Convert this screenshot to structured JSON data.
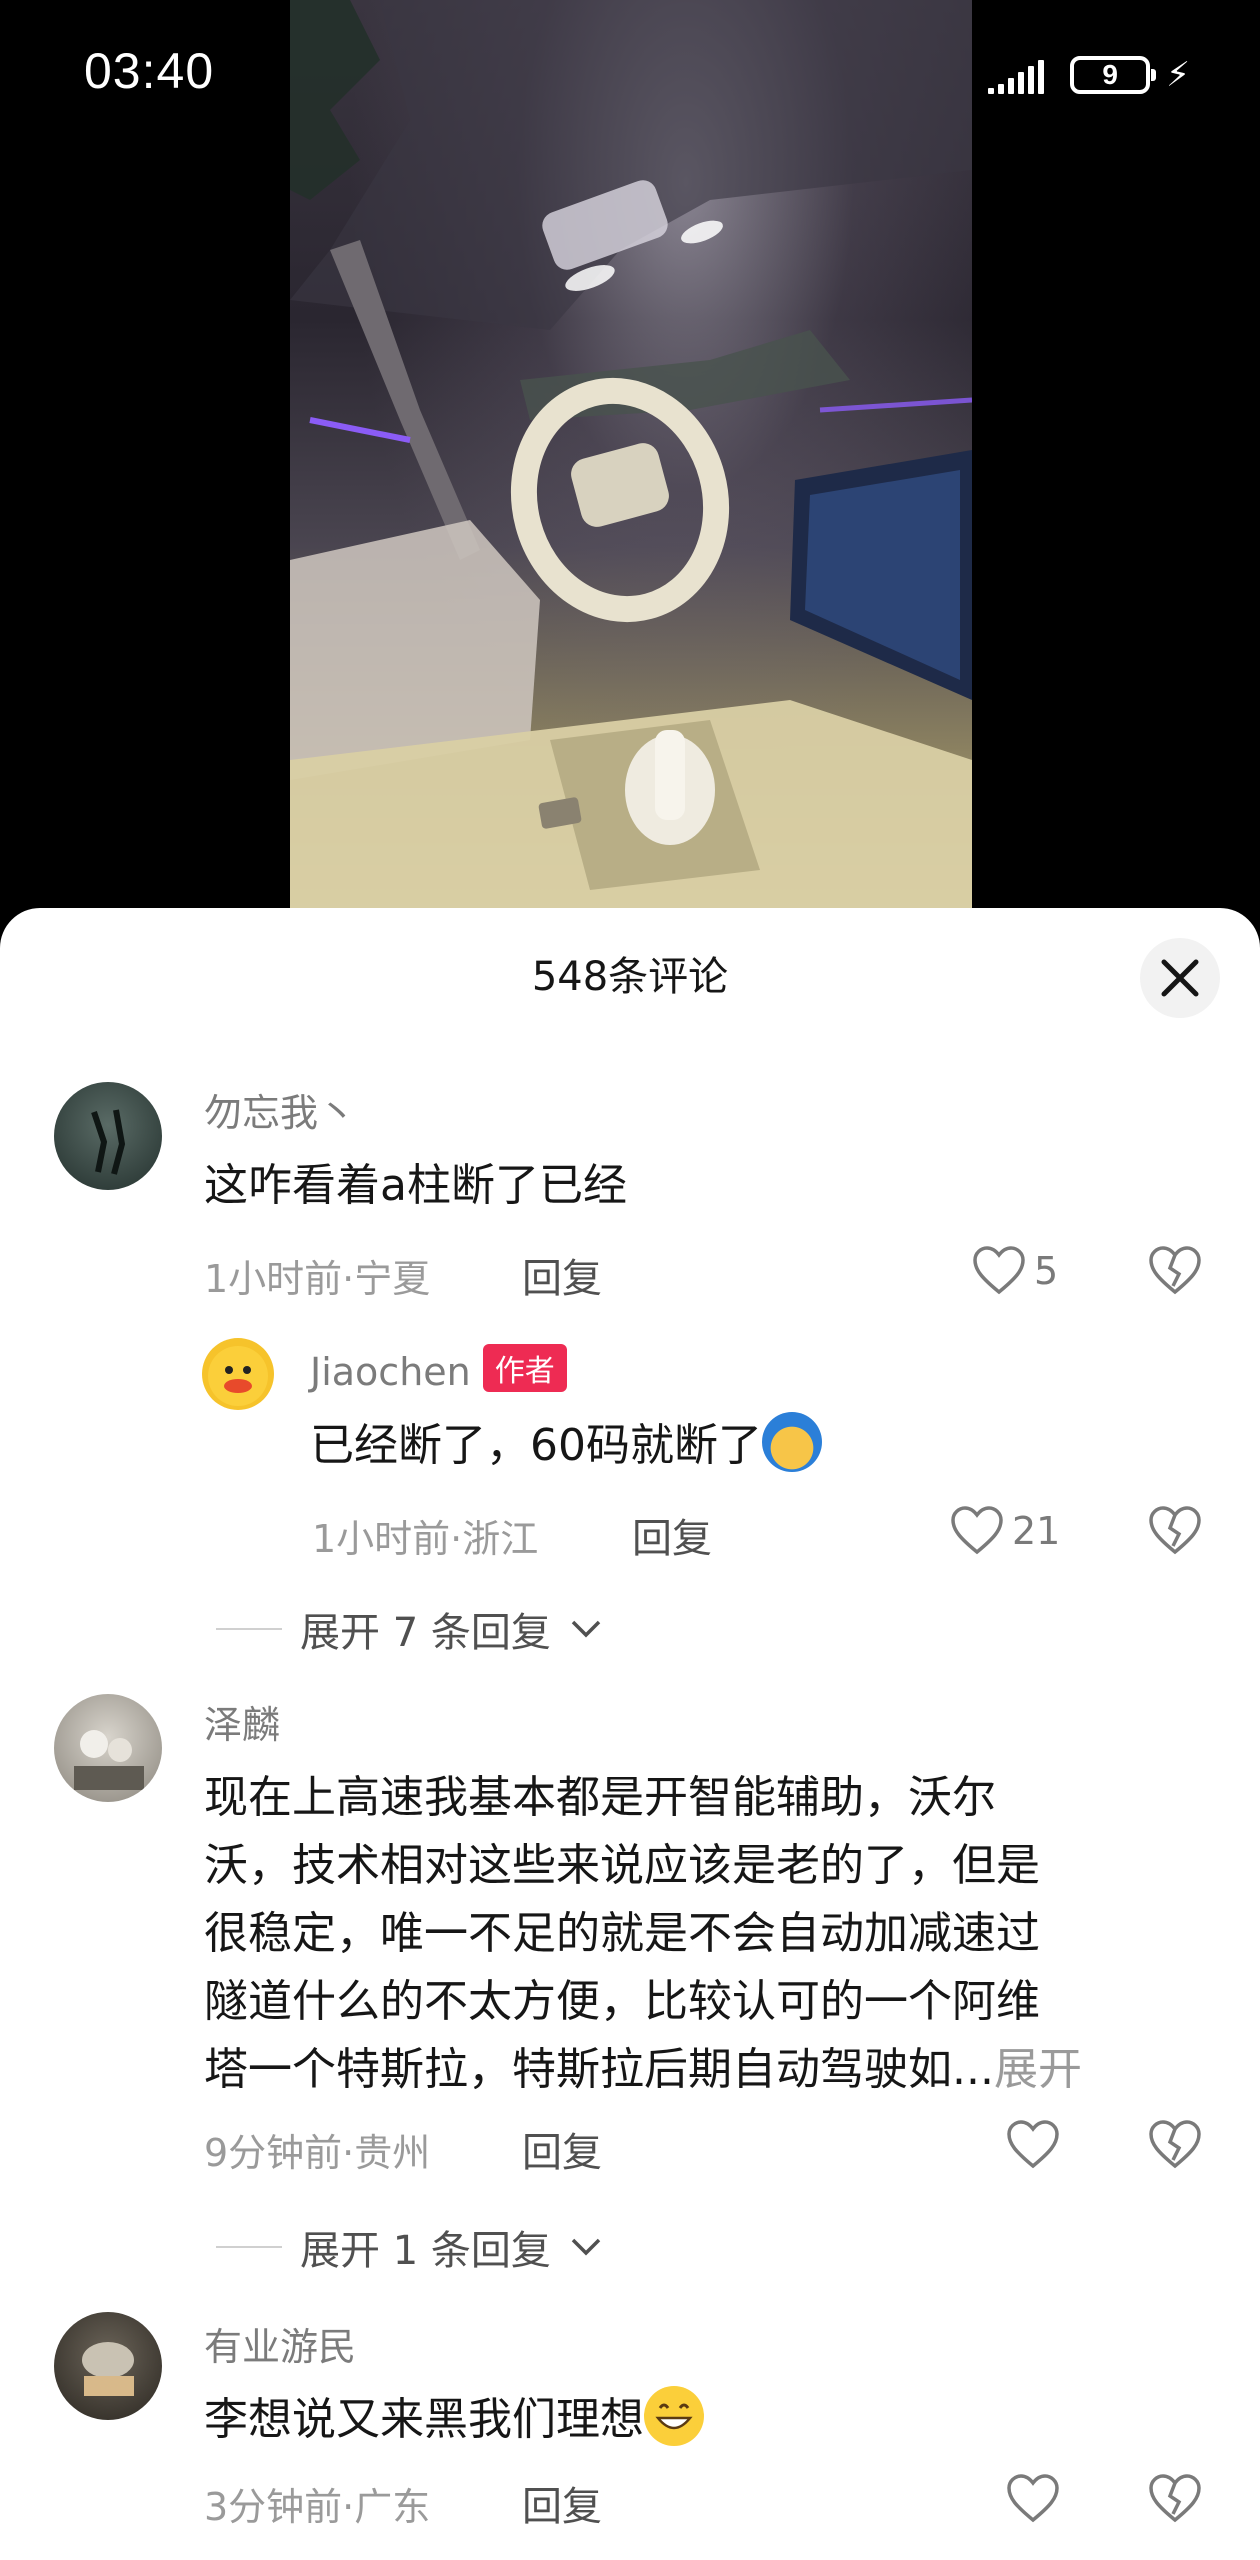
{
  "status_bar": {
    "time": "03:40",
    "network": "4G",
    "battery": "9",
    "icons": [
      "signal-4g-icon",
      "signal-bars-icon",
      "battery-icon",
      "charging-bolt-icon"
    ]
  },
  "video": {
    "description_icon": "car-interior-photo"
  },
  "comments_sheet": {
    "title": "548条评论",
    "close_icon": "close-icon",
    "comments": [
      {
        "user": "勿忘我丶",
        "text": "这咋看着a柱断了已经",
        "time_location": "1小时前·宁夏",
        "reply_label": "回复",
        "likes": "5"
      },
      {
        "user": "Jiaochen",
        "badge": "作者",
        "text": "已经断了，60码就断了",
        "time_location": "1小时前·浙江",
        "reply_label": "回复",
        "likes": "21",
        "expand_label": "展开 7 条回复"
      },
      {
        "user": "泽麟",
        "text_lines": [
          "现在上高速我基本都是开智能辅助，沃尔",
          "沃，技术相对这些来说应该是老的了，但是",
          "很稳定，唯一不足的就是不会自动加减速过",
          "隧道什么的不太方便，比较认可的一个阿维",
          "塔一个特斯拉，特斯拉后期自动驾驶如..."
        ],
        "more_label": "展开",
        "time_location": "9分钟前·贵州",
        "reply_label": "回复",
        "likes": "",
        "expand_label": "展开 1 条回复"
      },
      {
        "user": "有业游民",
        "text": "李想说又来黑我们理想",
        "time_location": "3分钟前·广东",
        "reply_label": "回复",
        "likes": ""
      }
    ]
  },
  "colors": {
    "author_badge": "#ee2b53",
    "text_primary": "#161616",
    "text_secondary": "#9a9a9a"
  }
}
